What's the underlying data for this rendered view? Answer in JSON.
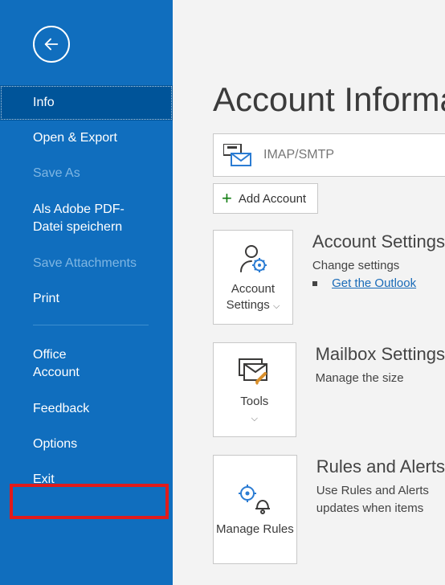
{
  "sidebar": {
    "items": [
      {
        "label": "Info",
        "selected": true
      },
      {
        "label": "Open & Export"
      },
      {
        "label": "Save As",
        "disabled": true
      },
      {
        "label": "Als Adobe PDF-Datei speichern"
      },
      {
        "label": "Save Attachments",
        "disabled": true
      },
      {
        "label": "Print"
      },
      {
        "label": "Office Account"
      },
      {
        "label": "Feedback"
      },
      {
        "label": "Options"
      },
      {
        "label": "Exit"
      }
    ]
  },
  "page": {
    "title": "Account Information"
  },
  "account": {
    "type": "IMAP/SMTP",
    "add_label": "Add Account"
  },
  "sections": {
    "settings": {
      "button1": "Account",
      "button2": "Settings",
      "title": "Account Settings",
      "desc": "Change settings",
      "link": "Get the Outlook"
    },
    "mailbox": {
      "button": "Tools",
      "title": "Mailbox Settings",
      "desc": "Manage the size"
    },
    "rules": {
      "button": "Manage Rules",
      "title": "Rules and Alerts",
      "desc1": "Use Rules and Alerts",
      "desc2": "updates when items"
    }
  }
}
